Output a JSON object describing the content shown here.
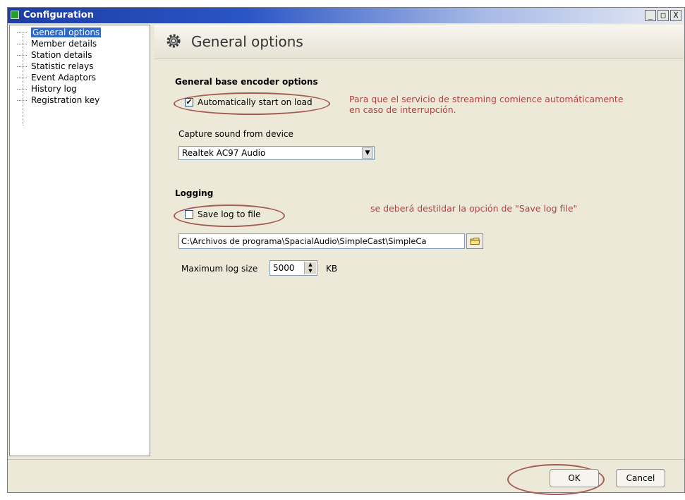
{
  "window": {
    "title": "Configuration",
    "controls": [
      "_",
      "□",
      "X"
    ]
  },
  "sidebar": {
    "items": [
      {
        "label": "General options",
        "selected": true
      },
      {
        "label": "Member details"
      },
      {
        "label": "Station details"
      },
      {
        "label": "Statistic relays"
      },
      {
        "label": "Event Adaptors"
      },
      {
        "label": "History log"
      },
      {
        "label": "Registration key"
      }
    ]
  },
  "panel": {
    "title": "General options",
    "icon": "gear-icon"
  },
  "encoder": {
    "section_title": "General base encoder options",
    "auto_start_label": "Automatically start on load",
    "auto_start_checked": true,
    "note": "Para que el servicio de streaming comience automáticamente en caso de interrupción.",
    "capture_label": "Capture sound from device",
    "capture_value": "Realtek AC97 Audio"
  },
  "logging": {
    "section_title": "Logging",
    "save_log_label": "Save log to file",
    "save_log_checked": false,
    "note": "se deberá destildar la opción de \"Save log file\"",
    "path_value": "C:\\Archivos de programa\\SpacialAudio\\SimpleCast\\SimpleCa",
    "max_size_label": "Maximum log size",
    "max_size_value": "5000",
    "max_size_unit": "KB"
  },
  "footer": {
    "ok_label": "OK",
    "cancel_label": "Cancel"
  },
  "colors": {
    "annotation": "#a55a55",
    "selection": "#316ac5"
  }
}
